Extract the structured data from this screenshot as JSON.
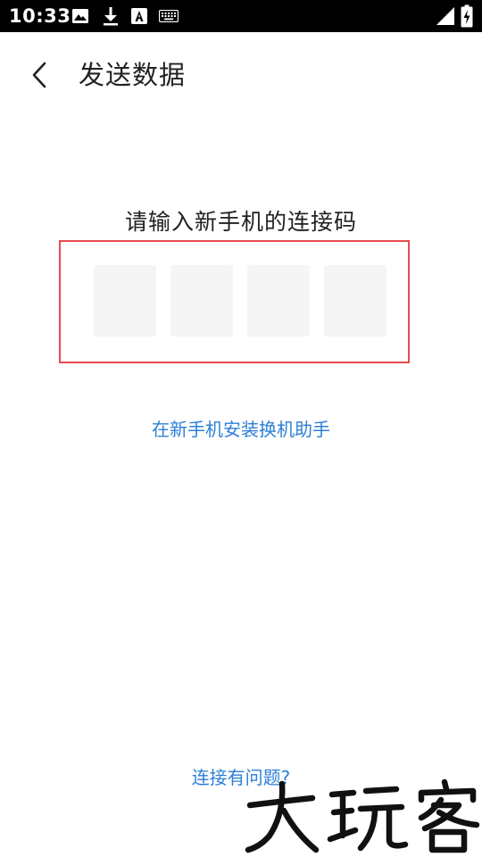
{
  "status_bar": {
    "time": "10:33",
    "notification_icons": [
      "image-icon",
      "download-icon",
      "font-icon",
      "keyboard-icon"
    ],
    "system_icons": [
      "signal-icon",
      "battery-charging-icon"
    ]
  },
  "header": {
    "back_icon": "chevron-left-icon",
    "title": "发送数据"
  },
  "main": {
    "prompt": "请输入新手机的连接码",
    "code_length": 4,
    "code_digits": [
      "",
      "",
      "",
      ""
    ],
    "install_link": "在新手机安装换机助手",
    "problem_link": "连接有问题?"
  },
  "overlay": {
    "watermark_text": "大玩客"
  },
  "colors": {
    "status_bar_bg": "#000000",
    "link": "#2d7fd8",
    "highlight_border": "#e84a4f",
    "code_cell_bg": "#f5f5f5",
    "title_text": "#222222"
  }
}
